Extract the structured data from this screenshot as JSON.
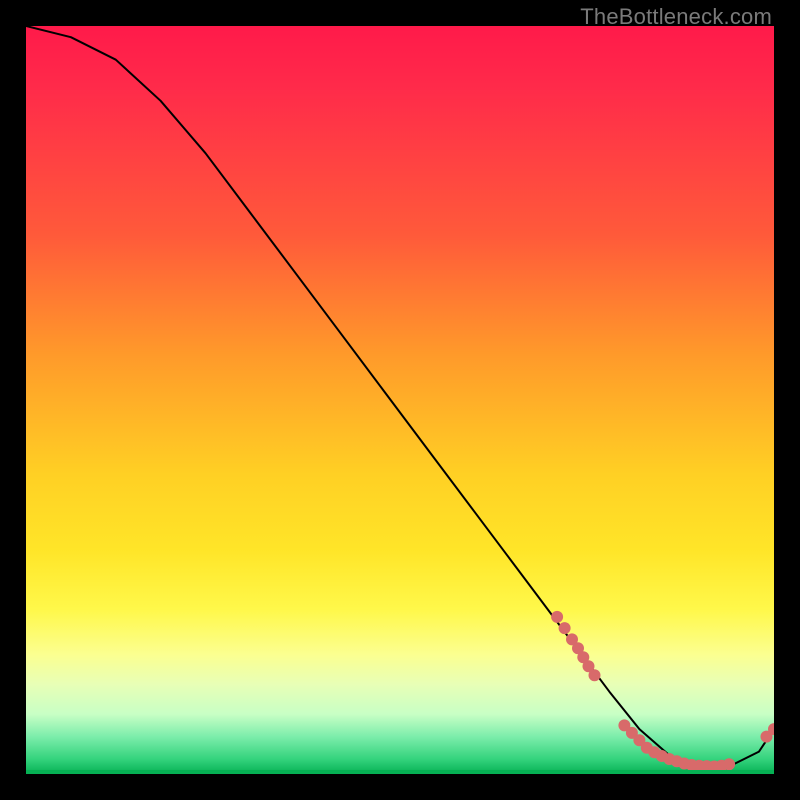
{
  "watermark": {
    "text": "TheBottleneck.com"
  },
  "chart_data": {
    "type": "line",
    "title": "",
    "xlabel": "",
    "ylabel": "",
    "xlim": [
      0,
      100
    ],
    "ylim": [
      0,
      100
    ],
    "grid": false,
    "legend": false,
    "series": [
      {
        "name": "bottleneck-curve",
        "color": "#000000",
        "x": [
          0,
          6,
          12,
          18,
          24,
          30,
          36,
          42,
          48,
          54,
          60,
          66,
          72,
          78,
          82,
          86,
          90,
          94,
          98,
          100
        ],
        "y": [
          100,
          98.5,
          95.5,
          90,
          83,
          75,
          67,
          59,
          51,
          43,
          35,
          27,
          19,
          11,
          6,
          2.5,
          1,
          1,
          3,
          6
        ]
      }
    ],
    "dot_clusters": [
      {
        "name": "cluster-upper",
        "color": "#d86a6a",
        "points": [
          {
            "x": 71,
            "y": 21
          },
          {
            "x": 72,
            "y": 19.5
          },
          {
            "x": 73,
            "y": 18
          },
          {
            "x": 73.8,
            "y": 16.8
          },
          {
            "x": 74.5,
            "y": 15.6
          },
          {
            "x": 75.2,
            "y": 14.4
          },
          {
            "x": 76,
            "y": 13.2
          }
        ]
      },
      {
        "name": "cluster-valley",
        "color": "#d86a6a",
        "points": [
          {
            "x": 80,
            "y": 6.5
          },
          {
            "x": 81,
            "y": 5.5
          },
          {
            "x": 82,
            "y": 4.5
          },
          {
            "x": 83,
            "y": 3.5
          },
          {
            "x": 84,
            "y": 2.9
          },
          {
            "x": 85,
            "y": 2.4
          },
          {
            "x": 86,
            "y": 2
          },
          {
            "x": 87,
            "y": 1.7
          },
          {
            "x": 88,
            "y": 1.4
          },
          {
            "x": 89,
            "y": 1.2
          },
          {
            "x": 90,
            "y": 1.1
          },
          {
            "x": 91,
            "y": 1.05
          },
          {
            "x": 92,
            "y": 1
          },
          {
            "x": 93,
            "y": 1.1
          },
          {
            "x": 94,
            "y": 1.3
          }
        ]
      },
      {
        "name": "cluster-rise",
        "color": "#d86a6a",
        "points": [
          {
            "x": 99,
            "y": 5
          },
          {
            "x": 100,
            "y": 6
          }
        ]
      }
    ],
    "background_gradient": {
      "type": "vertical",
      "stops": [
        {
          "pos": 0.0,
          "color": "#ff1a4a"
        },
        {
          "pos": 0.28,
          "color": "#ff5a3a"
        },
        {
          "pos": 0.6,
          "color": "#ffd024"
        },
        {
          "pos": 0.78,
          "color": "#fff84a"
        },
        {
          "pos": 0.92,
          "color": "#c8ffc5"
        },
        {
          "pos": 1.0,
          "color": "#06b154"
        }
      ]
    }
  }
}
